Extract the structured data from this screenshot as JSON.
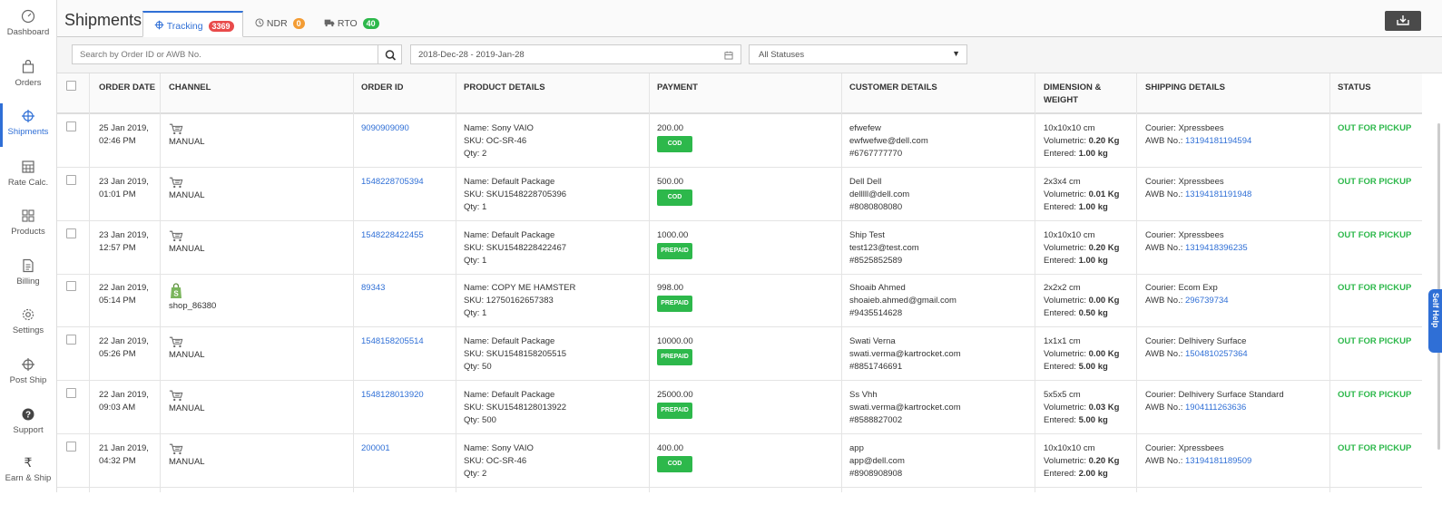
{
  "sidebar": {
    "items": [
      {
        "label": "Dashboard",
        "icon": "dashboard-icon"
      },
      {
        "label": "Orders",
        "icon": "orders-icon"
      },
      {
        "label": "Shipments",
        "icon": "shipments-icon"
      },
      {
        "label": "Rate Calc.",
        "icon": "calculator-icon"
      },
      {
        "label": "Products",
        "icon": "products-icon"
      },
      {
        "label": "Billing",
        "icon": "billing-icon"
      },
      {
        "label": "Settings",
        "icon": "gear-icon"
      },
      {
        "label": "Post Ship",
        "icon": "post-ship-icon"
      },
      {
        "label": "Support",
        "icon": "question-icon"
      },
      {
        "label": "Earn & Ship",
        "icon": "rupee-icon"
      }
    ],
    "active": "Shipments"
  },
  "header": {
    "title": "Shipments",
    "tabs": [
      {
        "label": "Tracking",
        "count": "3369",
        "badge_color": "#e94b4b"
      },
      {
        "label": "NDR",
        "count": "0",
        "badge_color": "#f39c34"
      },
      {
        "label": "RTO",
        "count": "40",
        "badge_color": "#2db84b"
      }
    ]
  },
  "filters": {
    "search_placeholder": "Search by Order ID or AWB No.",
    "date_range": "2018-Dec-28 - 2019-Jan-28",
    "status_selected": "All Statuses"
  },
  "table": {
    "columns": [
      "ORDER DATE",
      "CHANNEL",
      "ORDER ID",
      "PRODUCT DETAILS",
      "PAYMENT",
      "CUSTOMER DETAILS",
      "DIMENSION &",
      "WEIGHT",
      "SHIPPING DETAILS",
      "STATUS"
    ],
    "labels": {
      "volumetric": "Volumetric:",
      "entered": "Entered:",
      "courier": "Courier:",
      "awb": "AWB No.:"
    },
    "rows": [
      {
        "date": "25 Jan 2019,",
        "time": "02:46 PM",
        "channel": "MANUAL",
        "channel_icon": "cart-icon",
        "order_id": "9090909090",
        "product_name": "Name: Sony VAIO",
        "sku": "SKU: OC-SR-46",
        "qty": "Qty: 2",
        "amount": "200.00",
        "method": "COD",
        "cust_name": "efwefew",
        "cust_email": "ewfwefwe@dell.com",
        "cust_phone": "#6767777770",
        "dim": "10x10x10 cm",
        "volumetric": "0.20 Kg",
        "entered": "1.00 kg",
        "courier": "Xpressbees",
        "awb": "13194181194594",
        "status": "OUT FOR PICKUP"
      },
      {
        "date": "23 Jan 2019,",
        "time": "01:01 PM",
        "channel": "MANUAL",
        "channel_icon": "cart-icon",
        "order_id": "1548228705394",
        "product_name": "Name: Default Package",
        "sku": "SKU: SKU1548228705396",
        "qty": "Qty: 1",
        "amount": "500.00",
        "method": "COD",
        "cust_name": "Dell Dell",
        "cust_email": "delllll@dell.com",
        "cust_phone": "#8080808080",
        "dim": "2x3x4 cm",
        "volumetric": "0.01 Kg",
        "entered": "1.00 kg",
        "courier": "Xpressbees",
        "awb": "13194181191948",
        "status": "OUT FOR PICKUP"
      },
      {
        "date": "23 Jan 2019,",
        "time": "12:57 PM",
        "channel": "MANUAL",
        "channel_icon": "cart-icon",
        "order_id": "1548228422455",
        "product_name": "Name: Default Package",
        "sku": "SKU: SKU1548228422467",
        "qty": "Qty: 1",
        "amount": "1000.00",
        "method": "PREPAID",
        "cust_name": "Ship Test",
        "cust_email": "test123@test.com",
        "cust_phone": "#8525852589",
        "dim": "10x10x10 cm",
        "volumetric": "0.20 Kg",
        "entered": "1.00 kg",
        "courier": "Xpressbees",
        "awb": "1319418396235",
        "status": "OUT FOR PICKUP"
      },
      {
        "date": "22 Jan 2019,",
        "time": "05:14 PM",
        "channel": "shop_86380",
        "channel_icon": "shopify-icon",
        "order_id": "89343",
        "product_name": "Name: COPY ME HAMSTER",
        "sku": "SKU: 12750162657383",
        "qty": "Qty: 1",
        "amount": "998.00",
        "method": "PREPAID",
        "cust_name": "Shoaib Ahmed",
        "cust_email": "shoaieb.ahmed@gmail.com",
        "cust_phone": "#9435514628",
        "dim": "2x2x2 cm",
        "volumetric": "0.00 Kg",
        "entered": "0.50 kg",
        "courier": "Ecom Exp",
        "awb": "296739734",
        "status": "OUT FOR PICKUP"
      },
      {
        "date": "22 Jan 2019,",
        "time": "05:26 PM",
        "channel": "MANUAL",
        "channel_icon": "cart-icon",
        "order_id": "1548158205514",
        "product_name": "Name: Default Package",
        "sku": "SKU: SKU1548158205515",
        "qty": "Qty: 50",
        "amount": "10000.00",
        "method": "PREPAID",
        "cust_name": "Swati Verna",
        "cust_email": "swati.verma@kartrocket.com",
        "cust_phone": "#8851746691",
        "dim": "1x1x1 cm",
        "volumetric": "0.00 Kg",
        "entered": "5.00 kg",
        "courier": "Delhivery Surface",
        "awb": "1504810257364",
        "status": "OUT FOR PICKUP"
      },
      {
        "date": "22 Jan 2019,",
        "time": "09:03 AM",
        "channel": "MANUAL",
        "channel_icon": "cart-icon",
        "order_id": "1548128013920",
        "product_name": "Name: Default Package",
        "sku": "SKU: SKU1548128013922",
        "qty": "Qty: 500",
        "amount": "25000.00",
        "method": "PREPAID",
        "cust_name": "Ss Vhh",
        "cust_email": "swati.verma@kartrocket.com",
        "cust_phone": "#8588827002",
        "dim": "5x5x5 cm",
        "volumetric": "0.03 Kg",
        "entered": "5.00 kg",
        "courier": "Delhivery Surface Standard",
        "awb": "1904111263636",
        "status": "OUT FOR PICKUP"
      },
      {
        "date": "21 Jan 2019,",
        "time": "04:32 PM",
        "channel": "MANUAL",
        "channel_icon": "cart-icon",
        "order_id": "200001",
        "product_name": "Name: Sony VAIO",
        "sku": "SKU: OC-SR-46",
        "qty": "Qty: 2",
        "amount": "400.00",
        "method": "COD",
        "cust_name": "app",
        "cust_email": "app@dell.com",
        "cust_phone": "#8908908908",
        "dim": "10x10x10 cm",
        "volumetric": "0.20 Kg",
        "entered": "2.00 kg",
        "courier": "Xpressbees",
        "awb": "13194181189509",
        "status": "OUT FOR PICKUP"
      }
    ]
  },
  "self_help": "Self Help",
  "colors": {
    "accent": "#2f6fd6",
    "success": "#2db84b"
  }
}
